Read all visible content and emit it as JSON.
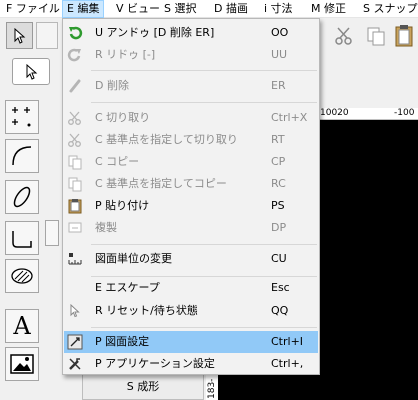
{
  "menubar": {
    "items": [
      {
        "label": "F ファイル"
      },
      {
        "label": "E 編集"
      },
      {
        "label": "V ビュー"
      },
      {
        "label": "S 選択"
      },
      {
        "label": "D 描画"
      },
      {
        "label": "i 寸法"
      },
      {
        "label": "M 修正"
      },
      {
        "label": "S スナップ"
      }
    ]
  },
  "edit_menu": {
    "items": [
      {
        "label": "U アンドゥ [D 削除 ER]",
        "shortcut": "OO",
        "icon": "undo-icon",
        "enabled": true
      },
      {
        "label": "R リドゥ [-]",
        "shortcut": "UU",
        "icon": "redo-icon",
        "enabled": false
      },
      {
        "label": "D 削除",
        "shortcut": "ER",
        "icon": "eraser-icon",
        "enabled": false
      },
      {
        "label": "C 切り取り",
        "shortcut": "Ctrl+X",
        "icon": "scissors-icon",
        "enabled": false
      },
      {
        "label": "C 基準点を指定して切り取り",
        "shortcut": "RT",
        "icon": "scissors-basepoint-icon",
        "enabled": false
      },
      {
        "label": "C コピー",
        "shortcut": "CP",
        "icon": "copy-icon",
        "enabled": false
      },
      {
        "label": "C 基準点を指定してコピー",
        "shortcut": "RC",
        "icon": "copy-basepoint-icon",
        "enabled": false
      },
      {
        "label": "P 貼り付け",
        "shortcut": "PS",
        "icon": "paste-icon",
        "enabled": true
      },
      {
        "label": "複製",
        "shortcut": "DP",
        "icon": "duplicate-icon",
        "enabled": false
      },
      {
        "label": "図面単位の変更",
        "shortcut": "CU",
        "icon": "units-icon",
        "enabled": true
      },
      {
        "label": "E エスケープ",
        "shortcut": "Esc",
        "icon": "",
        "enabled": true
      },
      {
        "label": "R リセット/待ち状態",
        "shortcut": "QQ",
        "icon": "cursor-icon",
        "enabled": true
      },
      {
        "label": "P 図面設定",
        "shortcut": "Ctrl+I",
        "icon": "drawing-settings-icon",
        "enabled": true
      },
      {
        "label": "P アプリケーション設定",
        "shortcut": "Ctrl+,",
        "icon": "app-settings-icon",
        "enabled": true
      }
    ]
  },
  "ruler": {
    "top_labels": [
      "10020",
      "-100"
    ],
    "left_label": "183-"
  },
  "bottom_tab": {
    "label": "S 成形"
  },
  "palette": {
    "text_tool_label": "A"
  },
  "colors": {
    "highlight": "#91c9f7",
    "canvas": "#000000",
    "menubar_active": "#cce8ff"
  }
}
